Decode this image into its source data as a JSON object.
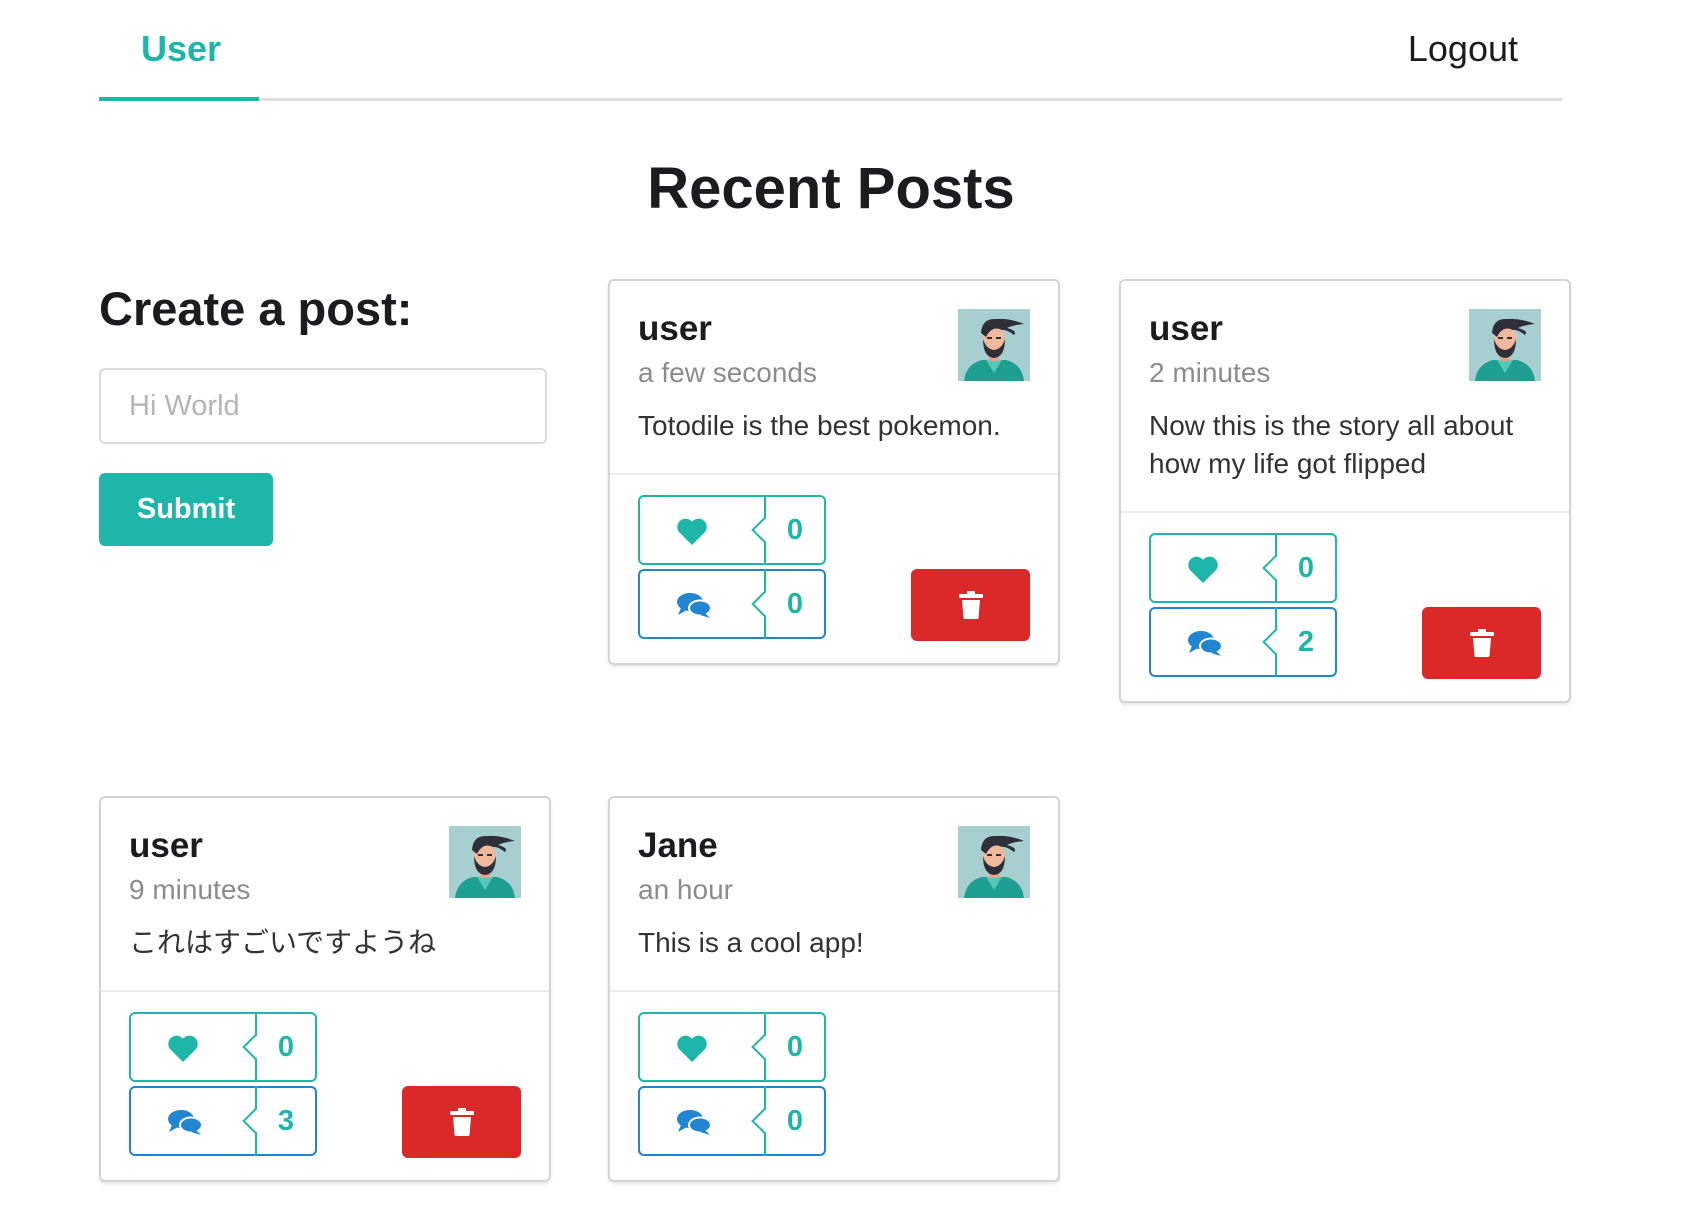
{
  "menu": {
    "active_tab": "User",
    "logout_label": "Logout"
  },
  "page_title": "Recent Posts",
  "create": {
    "title": "Create a post:",
    "placeholder": "Hi World",
    "value": "",
    "submit_label": "Submit"
  },
  "colors": {
    "teal": "#1fb6aa",
    "blue": "#2185d0",
    "red": "#db2828"
  },
  "icons": {
    "like": "heart-icon",
    "comment": "comments-icon",
    "delete": "trash-icon",
    "avatar": "bearded-man-avatar"
  },
  "posts": [
    {
      "author": "user",
      "time": "a few seconds",
      "text": "Totodile is the best pokemon.",
      "likes": "0",
      "comments": "0",
      "deletable": true
    },
    {
      "author": "user",
      "time": "2 minutes",
      "text": "Now this is the story all about how my life got flipped",
      "likes": "0",
      "comments": "2",
      "deletable": true
    },
    {
      "author": "user",
      "time": "9 minutes",
      "text": "これはすごいですようね",
      "likes": "0",
      "comments": "3",
      "deletable": true
    },
    {
      "author": "Jane",
      "time": "an hour",
      "text": "This is a cool app!",
      "likes": "0",
      "comments": "0",
      "deletable": false
    }
  ]
}
